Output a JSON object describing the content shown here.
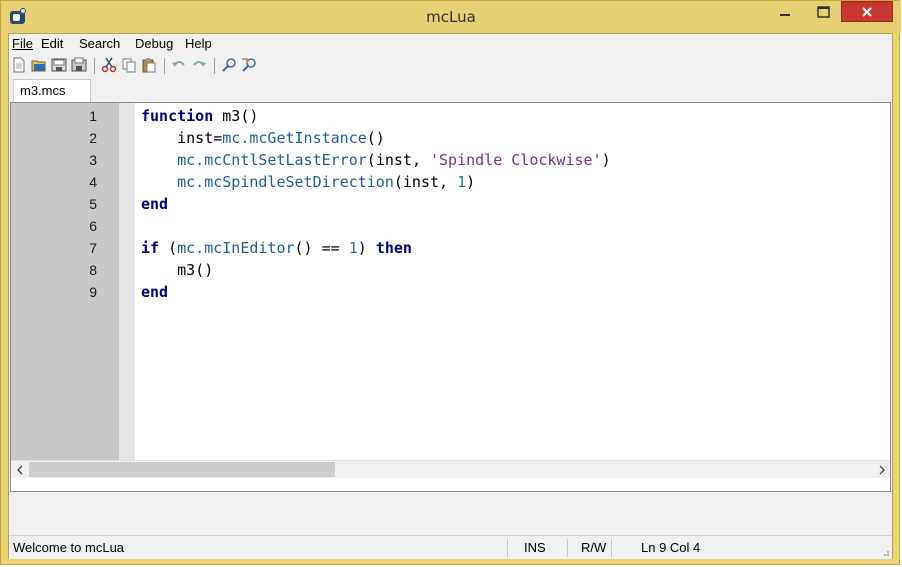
{
  "window": {
    "title": "mcLua"
  },
  "menu": [
    {
      "label": "File"
    },
    {
      "label": "Edit"
    },
    {
      "label": "Search"
    },
    {
      "label": "Debug"
    },
    {
      "label": "Help"
    }
  ],
  "toolbar": {
    "buttons": [
      "new-file-icon",
      "open-file-icon",
      "save-file-icon",
      "save-all-icon",
      "cut-icon",
      "copy-icon",
      "paste-icon",
      "undo-icon",
      "redo-icon",
      "find-icon",
      "find-replace-icon"
    ]
  },
  "tabs": [
    {
      "label": "m3.mcs"
    }
  ],
  "editor": {
    "line_numbers": [
      "1",
      "2",
      "3",
      "4",
      "5",
      "6",
      "7",
      "8",
      "9"
    ],
    "lines": [
      "function m3()",
      "    inst=mc.mcGetInstance()",
      "    mc.mcCntlSetLastError(inst, 'Spindle Clockwise')",
      "    mc.mcSpindleSetDirection(inst, 1)",
      "end",
      "",
      "if (mc.mcInEditor() == 1) then",
      "    m3()",
      "end"
    ]
  },
  "statusbar": {
    "message": "Welcome to mcLua",
    "mode": "INS",
    "access": "R/W",
    "position": "Ln 9 Col 4"
  },
  "colors": {
    "titlebar": "#e7cf73",
    "close_button": "#c7372f",
    "keyword": "#000080",
    "function": "#1e5aa8",
    "string": "#7d2b9a",
    "number": "#1e7a7a"
  }
}
